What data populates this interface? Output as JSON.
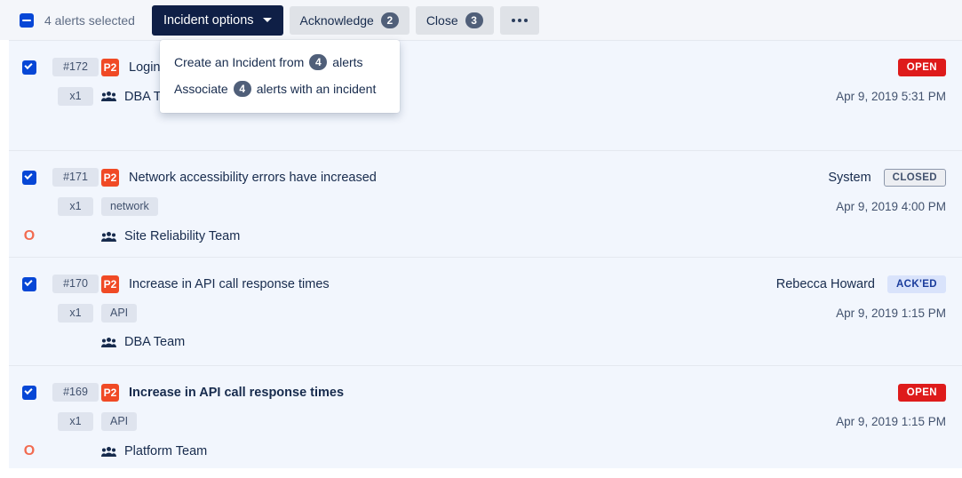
{
  "toolbar": {
    "selection_label": "4 alerts selected",
    "checkbox_state": "indeterminate",
    "incident_options_label": "Incident options",
    "acknowledge_label": "Acknowledge",
    "acknowledge_count": "2",
    "close_label": "Close",
    "close_count": "3",
    "more_label": "•••"
  },
  "dropdown": {
    "items": [
      {
        "prefix": "Create an Incident from",
        "count": "4",
        "suffix": "alerts",
        "name": "create-incident-from-alerts"
      },
      {
        "prefix": "Associate",
        "count": "4",
        "suffix": "alerts with an incident",
        "name": "associate-alerts-with-incident"
      }
    ]
  },
  "colors": {
    "accent_blue": "#0747d6",
    "priority_red": "#f04a25",
    "open_red": "#de1b1b",
    "acked_blue_bg": "#d9e3fb",
    "source_orange": "#f26b50",
    "row_bg": "#f2f6fd",
    "toolbar_bg": "#f4f6fa"
  },
  "alerts": [
    {
      "checked": true,
      "id": "#172",
      "count": "x1",
      "priority": "P2",
      "title": "Login",
      "title_bold": false,
      "tag": "",
      "team": "DBA T",
      "owner": "",
      "status": "OPEN",
      "status_kind": "open",
      "time": "Apr 9, 2019 5:31 PM",
      "source_icon": ""
    },
    {
      "checked": true,
      "id": "#171",
      "count": "x1",
      "priority": "P2",
      "title": "Network accessibility errors have increased",
      "title_bold": false,
      "tag": "network",
      "team": "Site Reliability Team",
      "owner": "System",
      "status": "CLOSED",
      "status_kind": "closed",
      "time": "Apr 9, 2019 4:00 PM",
      "source_icon": "O"
    },
    {
      "checked": true,
      "id": "#170",
      "count": "x1",
      "priority": "P2",
      "title": "Increase in API call response times",
      "title_bold": false,
      "tag": "API",
      "team": "DBA Team",
      "owner": "Rebecca Howard",
      "status": "ACK'ED",
      "status_kind": "acked",
      "time": "Apr 9, 2019 1:15 PM",
      "source_icon": ""
    },
    {
      "checked": true,
      "id": "#169",
      "count": "x1",
      "priority": "P2",
      "title": "Increase in API call response times",
      "title_bold": true,
      "tag": "API",
      "team": "Platform Team",
      "owner": "",
      "status": "OPEN",
      "status_kind": "open",
      "time": "Apr 9, 2019 1:15 PM",
      "source_icon": "O"
    }
  ]
}
